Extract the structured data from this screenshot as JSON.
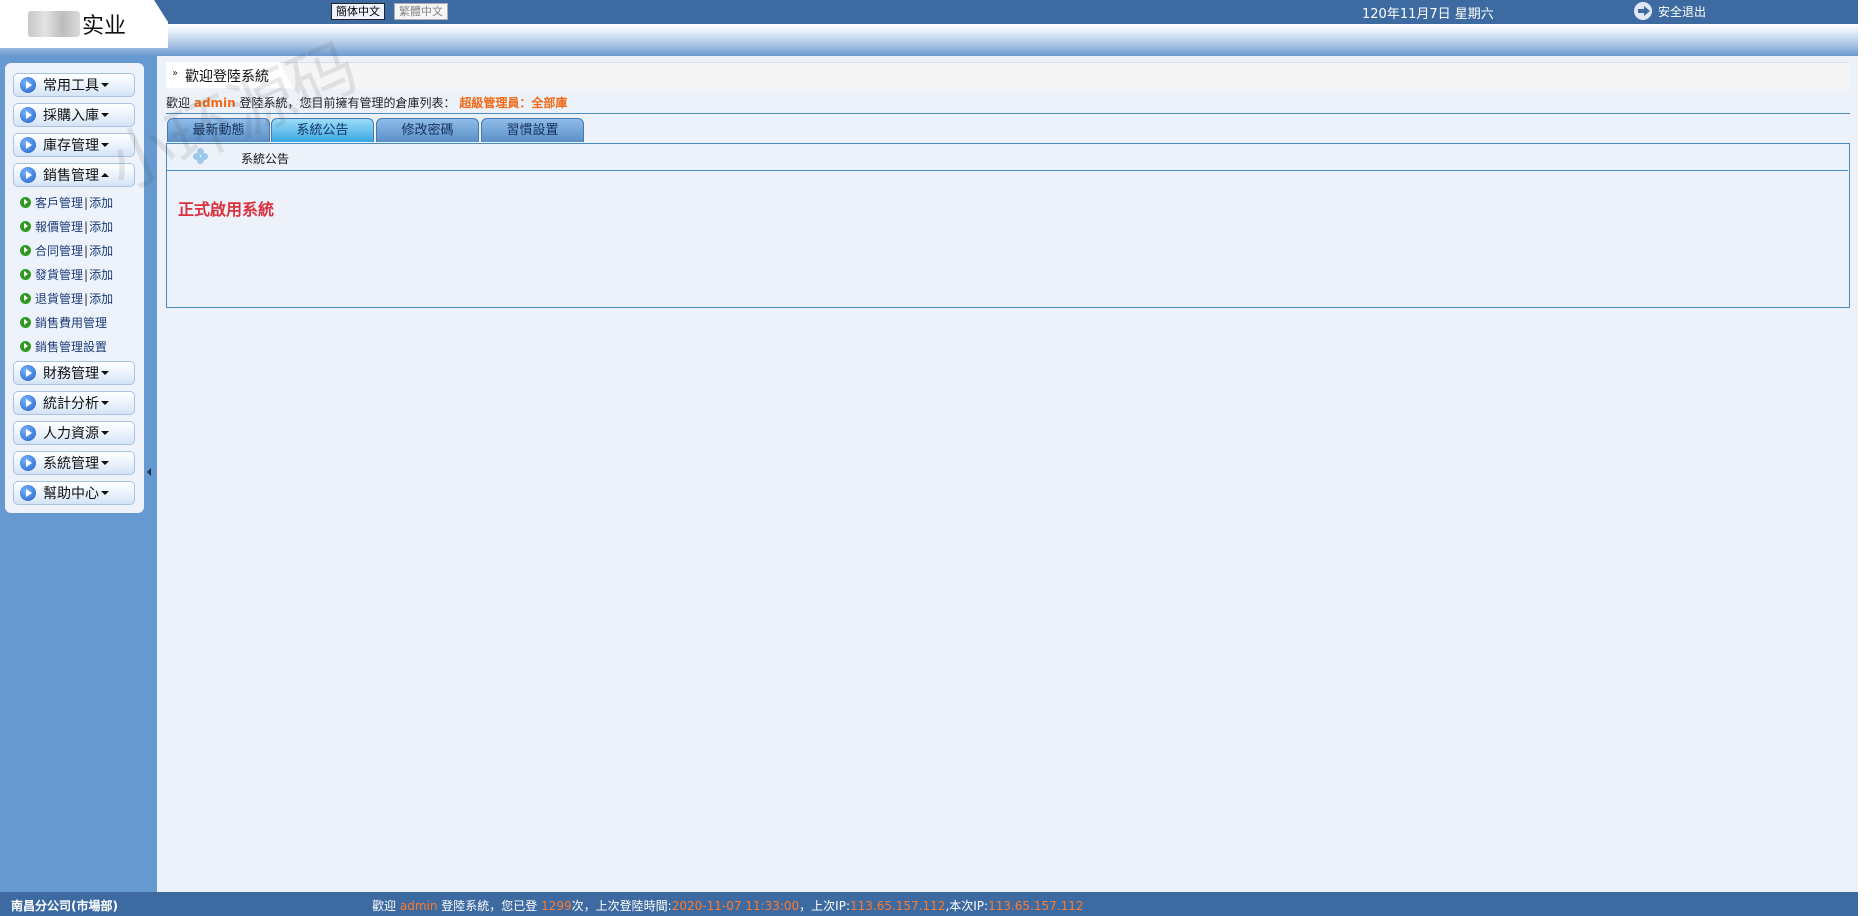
{
  "header": {
    "logo_text": "实业",
    "lang_simplified": "簡体中文",
    "lang_traditional": "繁體中文",
    "date": "120年11月7日 星期六",
    "logout": "安全退出"
  },
  "sidebar": {
    "menus": [
      {
        "label": "常用工具",
        "state": "collapsed"
      },
      {
        "label": "採購入庫",
        "state": "collapsed"
      },
      {
        "label": "庫存管理",
        "state": "collapsed"
      },
      {
        "label": "銷售管理",
        "state": "expanded"
      },
      {
        "label": "財務管理",
        "state": "collapsed"
      },
      {
        "label": "統計分析",
        "state": "collapsed"
      },
      {
        "label": "人力資源",
        "state": "collapsed"
      },
      {
        "label": "系統管理",
        "state": "collapsed"
      },
      {
        "label": "幫助中心",
        "state": "collapsed"
      }
    ],
    "sales_items": [
      {
        "label": "客戶管理",
        "add": "添加"
      },
      {
        "label": "報價管理",
        "add": "添加"
      },
      {
        "label": "合同管理",
        "add": "添加"
      },
      {
        "label": "發貨管理",
        "add": "添加"
      },
      {
        "label": "退貨管理",
        "add": "添加"
      },
      {
        "label": "銷售費用管理"
      },
      {
        "label": "銷售管理設置"
      }
    ],
    "separator": "|"
  },
  "main": {
    "title": "歡迎登陸系統",
    "welcome": {
      "prefix": "歡迎",
      "user": "admin",
      "middle": "登陸系統，您目前擁有管理的倉庫列表：",
      "role": "超級管理員：全部庫"
    },
    "tabs": [
      {
        "label": "最新動態",
        "active": false
      },
      {
        "label": "系統公告",
        "active": true
      },
      {
        "label": "修改密碼",
        "active": false
      },
      {
        "label": "習慣設置",
        "active": false
      }
    ],
    "box_title": "系統公告",
    "notice": "正式啟用系統"
  },
  "watermark": "小环源码",
  "footer": {
    "org": "南昌分公司(市場部)",
    "welcome_prefix": "歡迎",
    "user": "admin",
    "login_text": "登陸系統，您已登",
    "login_count": "1299",
    "count_suffix": "次，上次登陸時間:",
    "last_login_time": "2020-11-07 11:33:00",
    "last_ip_label": "，上次IP:",
    "last_ip": "113.65.157.112",
    "current_ip_label": ",本次IP:",
    "current_ip": "113.65.157.112"
  },
  "colors": {
    "header_bar": "#3d6aa0",
    "sidebar": "#6699d0",
    "highlight_orange": "#f06a18",
    "notice_red": "#d9323e"
  }
}
